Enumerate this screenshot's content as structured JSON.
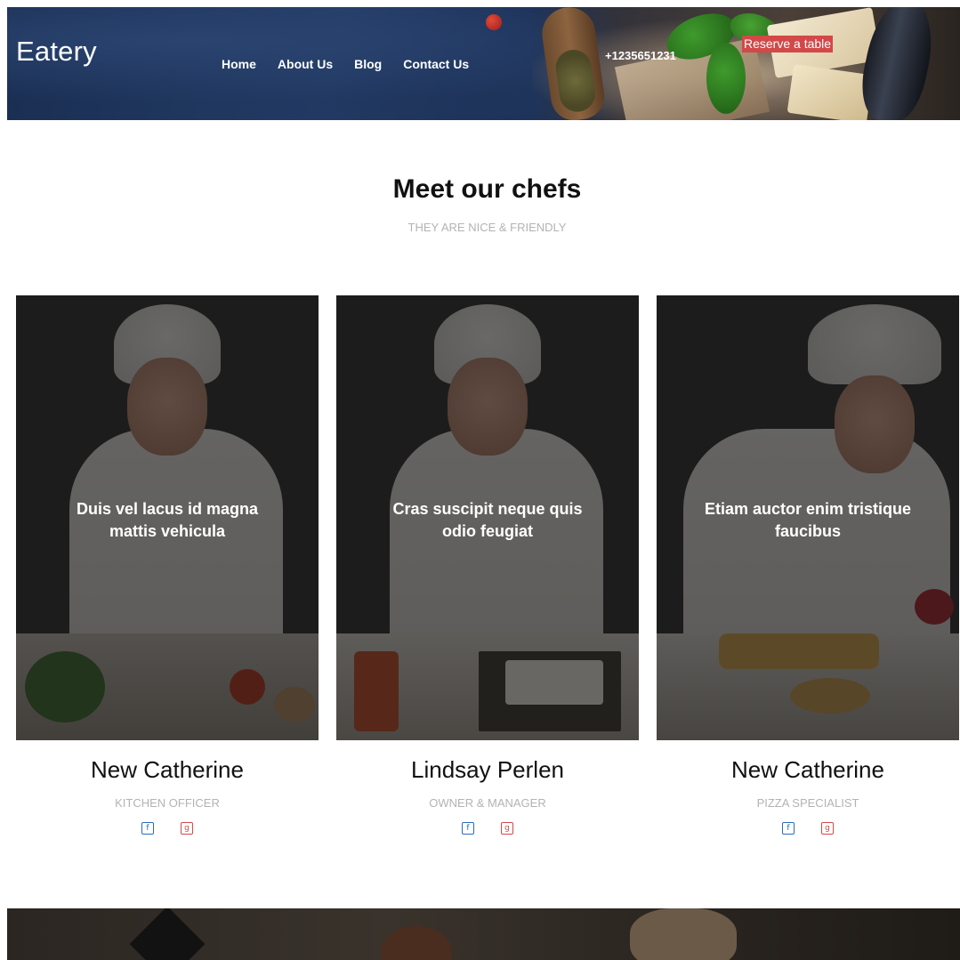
{
  "header": {
    "logo": "Eatery",
    "nav": [
      "Home",
      "About Us",
      "Blog",
      "Contact Us"
    ],
    "phone": "+1235651231",
    "reserve_label": "Reserve a table"
  },
  "section": {
    "title": "Meet our chefs",
    "subtitle": "THEY ARE NICE & FRIENDLY"
  },
  "chefs": [
    {
      "quote": "Duis vel lacus id magna mattis vehicula",
      "name": "New Catherine",
      "role": "KITCHEN OFFICER"
    },
    {
      "quote": "Cras suscipit neque quis odio feugiat",
      "name": "Lindsay Perlen",
      "role": "OWNER & MANAGER"
    },
    {
      "quote": "Etiam auctor enim tristique faucibus",
      "name": "New Catherine",
      "role": "PIZZA SPECIALIST"
    }
  ],
  "social_icons": [
    "facebook-icon",
    "google-plus-icon"
  ],
  "colors": {
    "accent": "#d34848",
    "facebook": "#2b6bb8",
    "header_bg": "#1f355c"
  }
}
